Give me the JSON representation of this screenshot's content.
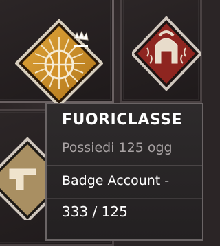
{
  "badges": [
    {
      "name": "basketball",
      "color": "#c98a1e"
    },
    {
      "name": "spartan-helmet",
      "color": "#9a2b24"
    },
    {
      "name": "pistol",
      "color": "#b89a68"
    }
  ],
  "tooltip": {
    "title": "FUORICLASSE",
    "description": "Possiedi 125 ogg",
    "type": "Badge Account -",
    "progress": "333 / 125"
  }
}
